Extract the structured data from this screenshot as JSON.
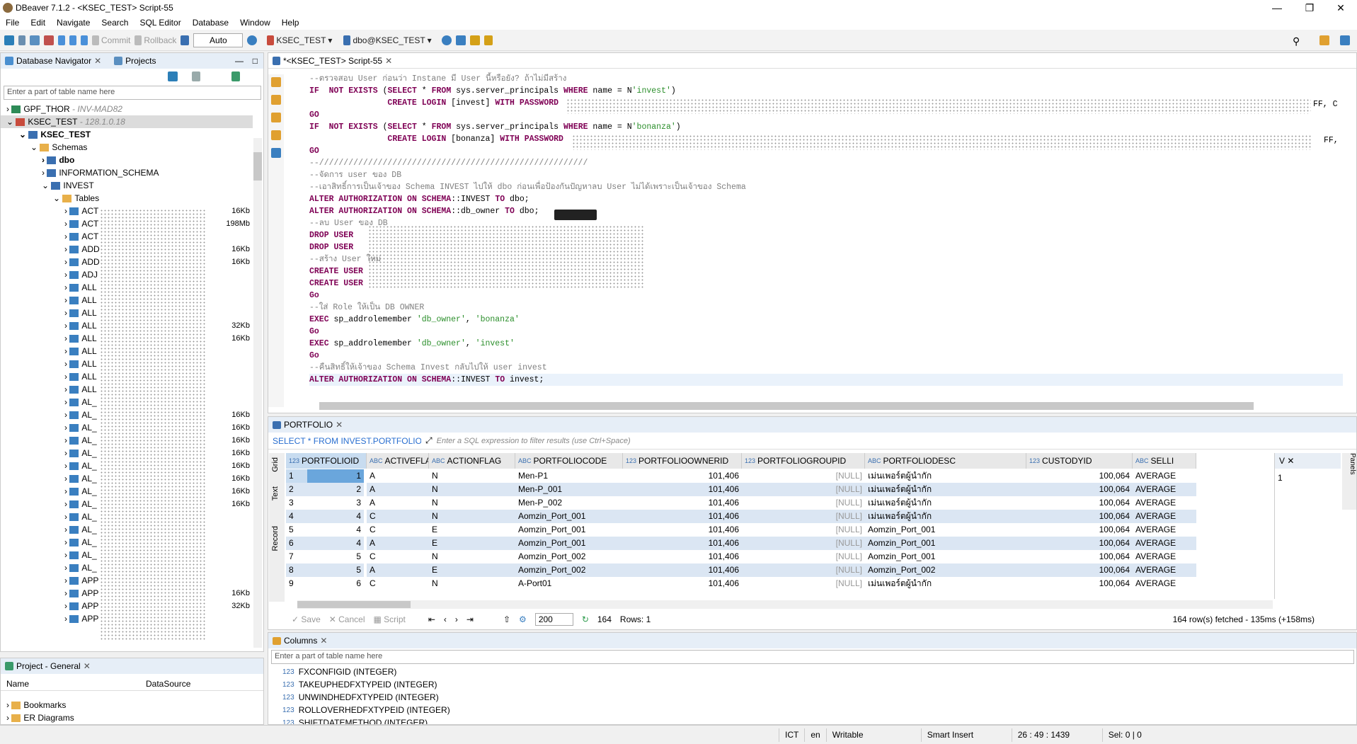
{
  "window": {
    "title": "DBeaver 7.1.2 - <KSEC_TEST> Script-55"
  },
  "menu": [
    "File",
    "Edit",
    "Navigate",
    "Search",
    "SQL Editor",
    "Database",
    "Window",
    "Help"
  ],
  "toolbar": {
    "commit": "Commit",
    "rollback": "Rollback",
    "mode": "Auto",
    "connection": "KSEC_TEST",
    "schema": "dbo@KSEC_TEST"
  },
  "navigator": {
    "tab1": "Database Navigator",
    "tab2": "Projects",
    "filter_placeholder": "Enter a part of table name here",
    "conn1": "GPF_THOR",
    "conn1_host": "- INV-MAD82",
    "conn2": "KSEC_TEST",
    "conn2_host": "- 128.1.0.18",
    "db": "KSEC_TEST",
    "schemas": "Schemas",
    "s1": "dbo",
    "s2": "INFORMATION_SCHEMA",
    "s3": "INVEST",
    "tables": "Tables",
    "rows": [
      {
        "n": "ACT",
        "s": "16Kb"
      },
      {
        "n": "ACT",
        "s": "198Mb"
      },
      {
        "n": "ACT",
        "s": ""
      },
      {
        "n": "ADD",
        "s": "16Kb"
      },
      {
        "n": "ADD",
        "s": "16Kb"
      },
      {
        "n": "ADJ",
        "s": ""
      },
      {
        "n": "ALL",
        "s": ""
      },
      {
        "n": "ALL",
        "s": ""
      },
      {
        "n": "ALL",
        "s": ""
      },
      {
        "n": "ALL",
        "s": "32Kb"
      },
      {
        "n": "ALL",
        "s": "16Kb"
      },
      {
        "n": "ALL",
        "s": ""
      },
      {
        "n": "ALL",
        "s": ""
      },
      {
        "n": "ALL",
        "s": ""
      },
      {
        "n": "ALL",
        "s": ""
      },
      {
        "n": "AL_",
        "s": ""
      },
      {
        "n": "AL_",
        "s": "16Kb"
      },
      {
        "n": "AL_",
        "s": "16Kb"
      },
      {
        "n": "AL_",
        "s": "16Kb"
      },
      {
        "n": "AL_",
        "s": "16Kb"
      },
      {
        "n": "AL_",
        "s": "16Kb"
      },
      {
        "n": "AL_",
        "s": "16Kb"
      },
      {
        "n": "AL_",
        "s": "16Kb"
      },
      {
        "n": "AL_",
        "s": "16Kb"
      },
      {
        "n": "AL_",
        "s": ""
      },
      {
        "n": "AL_",
        "s": ""
      },
      {
        "n": "AL_",
        "s": ""
      },
      {
        "n": "AL_",
        "s": ""
      },
      {
        "n": "AL_",
        "s": ""
      },
      {
        "n": "APP",
        "s": ""
      },
      {
        "n": "APP",
        "s": "16Kb"
      },
      {
        "n": "APP",
        "s": "32Kb"
      },
      {
        "n": "APP",
        "s": ""
      }
    ]
  },
  "project": {
    "tab": "Project - General",
    "col1": "Name",
    "col2": "DataSource",
    "items": [
      "Bookmarks",
      "ER Diagrams"
    ]
  },
  "editor": {
    "tab": "*<KSEC_TEST> Script-55",
    "lines": [
      {
        "t": "--ตรวจสอบ User ก่อนว่า Instane มี User นี้หรือยัง? ถ้าไม่มีสร้าง",
        "c": "cm"
      },
      {
        "t": "IF  NOT EXISTS (SELECT * FROM sys.server_principals WHERE name = N'invest')",
        "c": "mix"
      },
      {
        "t": "                CREATE LOGIN [invest] WITH PASSWORD",
        "c": "mix"
      },
      {
        "t": "GO",
        "c": "kw"
      },
      {
        "t": "IF  NOT EXISTS (SELECT * FROM sys.server_principals WHERE name = N'bonanza')",
        "c": "mix"
      },
      {
        "t": "                CREATE LOGIN [bonanza] WITH PASSWORD",
        "c": "mix"
      },
      {
        "t": "GO",
        "c": "kw"
      },
      {
        "t": "--///////////////////////////////////////////////////////",
        "c": "cm"
      },
      {
        "t": "--จัดการ user ของ DB",
        "c": "cm"
      },
      {
        "t": "--เอาสิทธิ์การเป็นเจ้าของ Schema INVEST ไปให้ dbo ก่อนเพื่อป้องกันปัญหาลบ User ไม่ได้เพราะเป็นเจ้าของ Schema",
        "c": "cm"
      },
      {
        "t": "ALTER AUTHORIZATION ON SCHEMA::INVEST TO dbo;",
        "c": "mix"
      },
      {
        "t": "ALTER AUTHORIZATION ON SCHEMA::db_owner TO dbo;",
        "c": "mix"
      },
      {
        "t": "--ลบ User ของ DB",
        "c": "cm"
      },
      {
        "t": "DROP USER",
        "c": "kw"
      },
      {
        "t": "DROP USER",
        "c": "kw"
      },
      {
        "t": "--สร้าง User ใหม่",
        "c": "cm"
      },
      {
        "t": "CREATE USER",
        "c": "kw"
      },
      {
        "t": "CREATE USER",
        "c": "kw"
      },
      {
        "t": "Go",
        "c": "kw"
      },
      {
        "t": "--ใส่ Role ให้เป็น DB OWNER",
        "c": "cm"
      },
      {
        "t": "EXEC sp_addrolemember 'db_owner', 'bonanza'",
        "c": "mix"
      },
      {
        "t": "Go",
        "c": "kw"
      },
      {
        "t": "EXEC sp_addrolemember 'db_owner', 'invest'",
        "c": "mix"
      },
      {
        "t": "Go",
        "c": "kw"
      },
      {
        "t": "--คืนสิทธิ์ให้เจ้าของ Schema Invest กลับไปให้ user invest",
        "c": "cm"
      },
      {
        "t": "ALTER AUTHORIZATION ON SCHEMA::INVEST TO invest;",
        "c": "mix"
      }
    ],
    "tail1": "FF, C",
    "tail2": "FF,"
  },
  "results": {
    "tab": "PORTFOLIO",
    "query": "SELECT * FROM INVEST.PORTFOLIO p",
    "filter_placeholder": "Enter a SQL expression to filter results (use Ctrl+Space)",
    "columns": [
      "PORTFOLIOID",
      "ACTIVEFLAG",
      "ACTIONFLAG",
      "PORTFOLIOCODE",
      "PORTFOLIOOWNERID",
      "PORTFOLIOGROUPID",
      "PORTFOLIODESC",
      "CUSTODYID",
      "SELLI"
    ],
    "rows": [
      [
        "1",
        "A",
        "N",
        "Men-P1",
        "101,406",
        "[NULL]",
        "เม่นเพอร์ตผู้นำกัก",
        "100,064",
        "AVERAGE"
      ],
      [
        "2",
        "A",
        "N",
        "Men-P_001",
        "101,406",
        "[NULL]",
        "เม่นเพอร์ตผู้นำกัก",
        "100,064",
        "AVERAGE"
      ],
      [
        "3",
        "A",
        "N",
        "Men-P_002",
        "101,406",
        "[NULL]",
        "เม่นเพอร์ตผู้นำกัก",
        "100,064",
        "AVERAGE"
      ],
      [
        "4",
        "C",
        "N",
        "Aomzin_Port_001",
        "101,406",
        "[NULL]",
        "เม่นเพอร์ตผู้นำกัก",
        "100,064",
        "AVERAGE"
      ],
      [
        "4",
        "C",
        "E",
        "Aomzin_Port_001",
        "101,406",
        "[NULL]",
        "Aomzin_Port_001",
        "100,064",
        "AVERAGE"
      ],
      [
        "4",
        "A",
        "E",
        "Aomzin_Port_001",
        "101,406",
        "[NULL]",
        "Aomzin_Port_001",
        "100,064",
        "AVERAGE"
      ],
      [
        "5",
        "C",
        "N",
        "Aomzin_Port_002",
        "101,406",
        "[NULL]",
        "Aomzin_Port_001",
        "100,064",
        "AVERAGE"
      ],
      [
        "5",
        "A",
        "E",
        "Aomzin_Port_002",
        "101,406",
        "[NULL]",
        "Aomzin_Port_002",
        "100,064",
        "AVERAGE"
      ],
      [
        "6",
        "C",
        "N",
        "A-Port01",
        "101,406",
        "[NULL]",
        "เม่นเพอร์ตผู้นำกัก",
        "100,064",
        "AVERAGE"
      ]
    ],
    "side": {
      "grid": "Grid",
      "text": "Text",
      "record": "Record",
      "panel_label": "V",
      "panel_value": "1",
      "panels": "Panels"
    },
    "footer": {
      "save": "Save",
      "cancel": "Cancel",
      "script": "Script",
      "limit": "200",
      "count": "164",
      "rows": "Rows: 1",
      "fetched": "164 row(s) fetched - 135ms (+158ms)"
    }
  },
  "columns_panel": {
    "tab": "Columns",
    "filter_placeholder": "Enter a part of table name here",
    "items": [
      "FXCONFIGID (INTEGER)",
      "TAKEUPHEDFXTYPEID (INTEGER)",
      "UNWINDHEDFXTYPEID (INTEGER)",
      "ROLLOVERHEDFXTYPEID (INTEGER)",
      "SHIFTDATEMETHOD (INTEGER)"
    ],
    "type_label": "123"
  },
  "status": {
    "tz": "ICT",
    "lang": "en",
    "mode": "Writable",
    "insert": "Smart Insert",
    "pos": "26 : 49 : 1439",
    "sel": "Sel: 0 | 0"
  },
  "colors": {
    "accent": "#3c78c8",
    "keyword": "#7f0055",
    "string": "#2a8e2a",
    "comment": "#808080"
  }
}
